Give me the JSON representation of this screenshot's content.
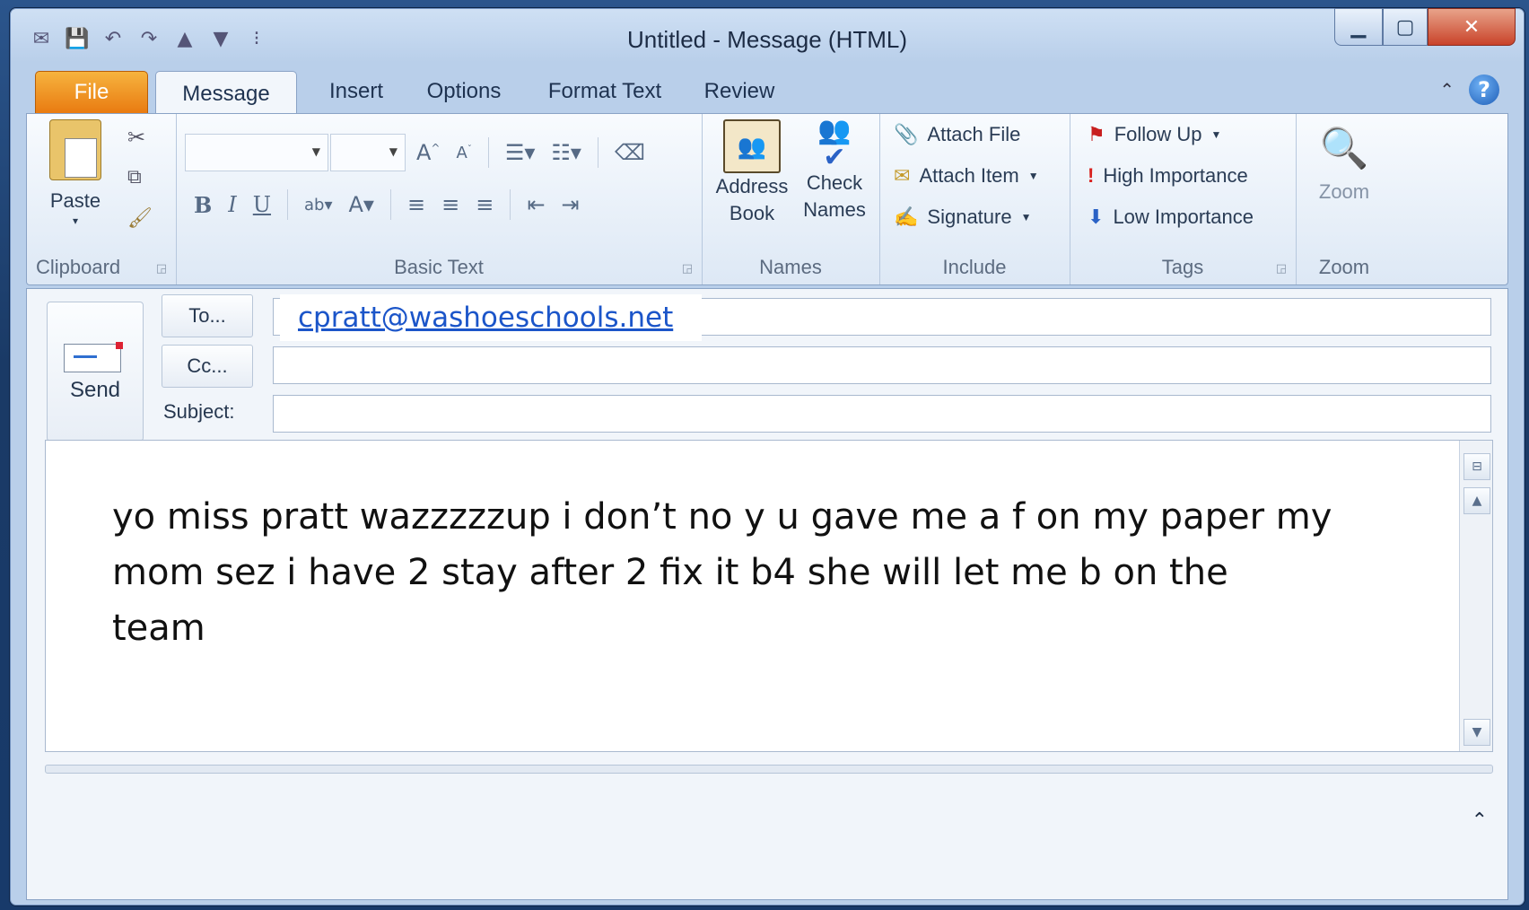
{
  "window": {
    "title": "Untitled  -  Message (HTML)"
  },
  "tabs": [
    "File",
    "Message",
    "Insert",
    "Options",
    "Format Text",
    "Review"
  ],
  "ribbon": {
    "clipboard": {
      "paste": "Paste",
      "label": "Clipboard"
    },
    "basic_text": {
      "label": "Basic Text"
    },
    "names": {
      "address_book": [
        "Address",
        "Book"
      ],
      "check_names": [
        "Check",
        "Names"
      ],
      "label": "Names"
    },
    "include": {
      "attach_file": "Attach File",
      "attach_item": "Attach Item",
      "signature": "Signature",
      "label": "Include"
    },
    "tags": {
      "follow_up": "Follow Up",
      "high_importance": "High Importance",
      "low_importance": "Low Importance",
      "label": "Tags"
    },
    "zoom": {
      "button": "Zoom",
      "label": "Zoom"
    }
  },
  "compose": {
    "send": "Send",
    "to_button": "To...",
    "cc_button": "Cc...",
    "subject_label": "Subject:",
    "to_value": "cpratt@washoeschools.net",
    "cc_value": "",
    "subject_value": "",
    "body_lines": [
      "yo miss pratt wazzzzzup i don’t no y u gave me a f on my paper my",
      "mom sez i have 2 stay after 2 fix it b4 she will let me b on the team"
    ]
  },
  "icons": [
    "save-icon",
    "undo-icon",
    "redo-icon",
    "up-arrow-icon",
    "down-arrow-icon",
    "minimize-icon",
    "maximize-icon",
    "close-icon",
    "help-icon",
    "collapse-ribbon-icon",
    "scissors-icon",
    "copy-icon",
    "format-painter-icon",
    "paperclip-icon",
    "flag-icon",
    "exclamation-icon",
    "down-arrow-blue-icon",
    "magnifier-icon"
  ],
  "colors": {
    "file_tab": "#e97b11",
    "link": "#1b55c9",
    "close_button": "#c9432a"
  }
}
